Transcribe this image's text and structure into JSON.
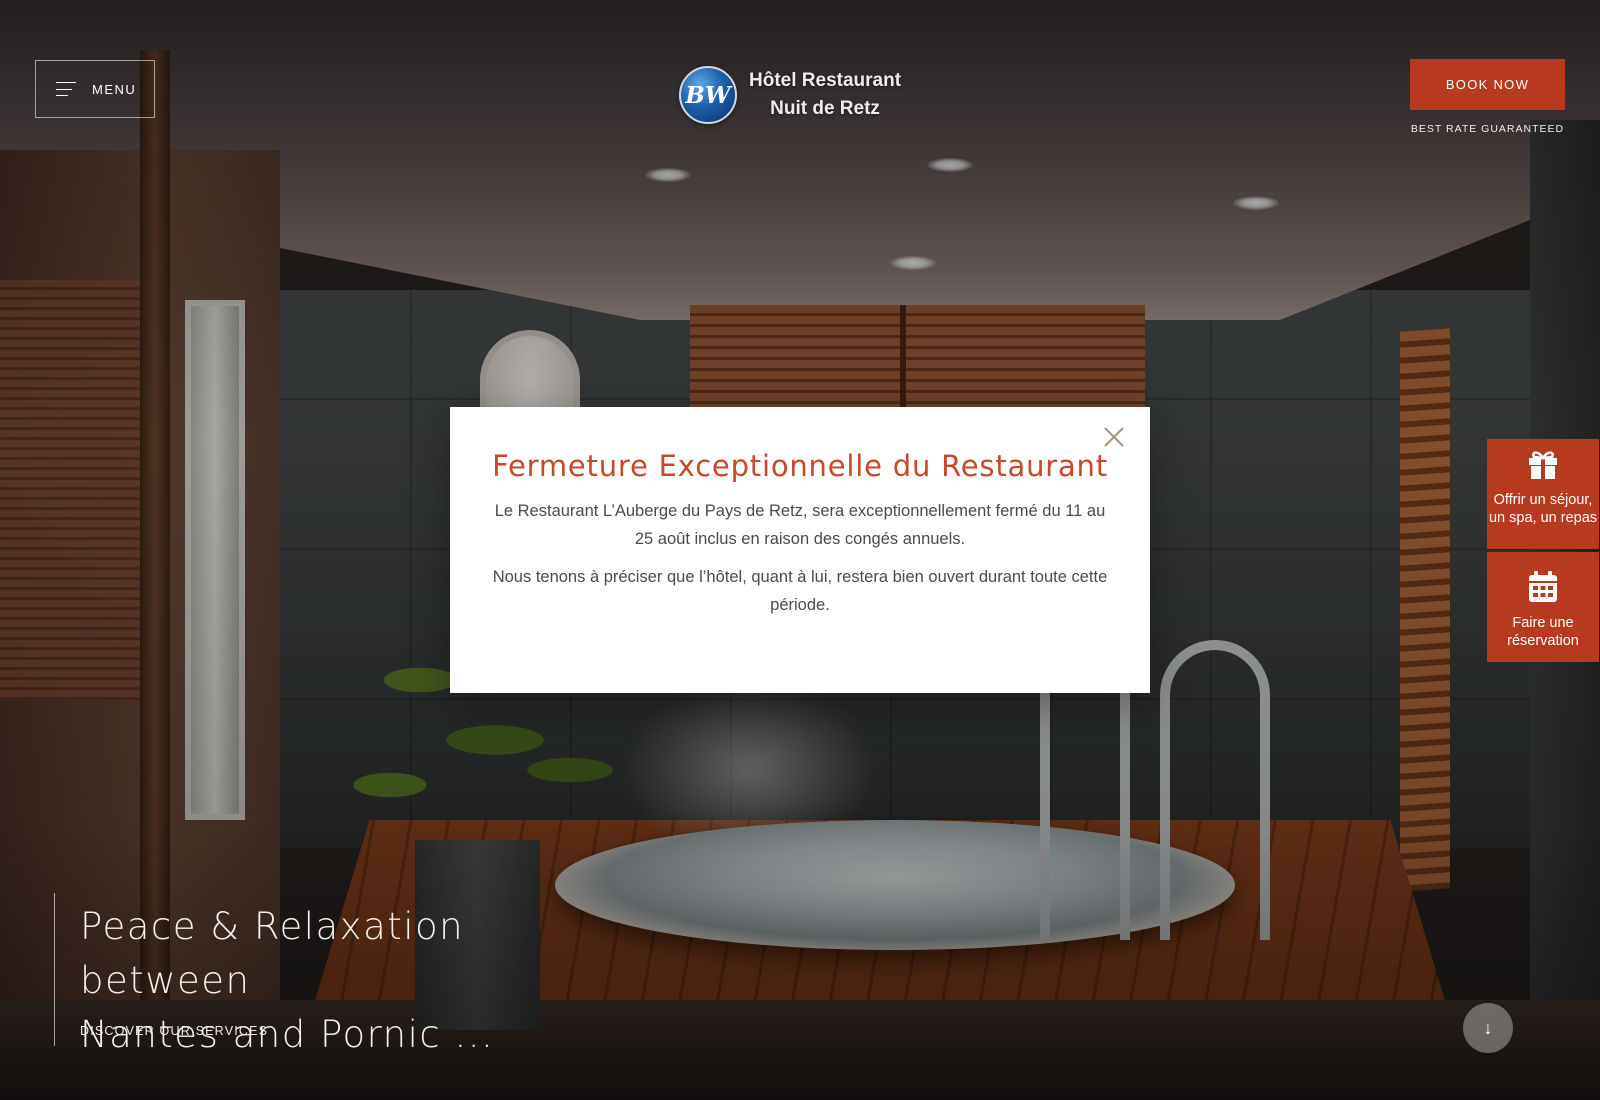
{
  "header": {
    "menu_label": "MENU",
    "logo_badge": "BW",
    "logo_line1": "Hôtel Restaurant",
    "logo_line2": "Nuit de Retz",
    "book_now": "BOOK NOW",
    "best_rate": "BEST RATE GUARANTEED"
  },
  "side_tabs": {
    "gift": "Offrir un séjour, un spa, un repas",
    "reservation": "Faire une réservation"
  },
  "hero": {
    "title_line1": "Peace & Relaxation between",
    "title_line2": "Nantes and Pornic ...",
    "cta": "DISCOVER OUR SERVICES",
    "scroll_icon": "↓"
  },
  "modal": {
    "title": "Fermeture Exceptionnelle du Restaurant",
    "paragraph1": "Le Restaurant L’Auberge du Pays de Retz, sera exceptionnellement fermé du 11 au 25 août inclus en raison des congés annuels.",
    "paragraph2": "Nous tenons à préciser que l’hôtel, quant à lui, restera bien ouvert durant toute cette période."
  },
  "icons": {
    "menu": "hamburger-icon",
    "gift": "gift-icon",
    "calendar": "calendar-icon",
    "close": "close-icon",
    "scroll": "arrow-down-icon"
  },
  "colors": {
    "accent": "#b73a1e",
    "modal_title": "#c64a2a",
    "modal_text": "#4b4b4b"
  }
}
